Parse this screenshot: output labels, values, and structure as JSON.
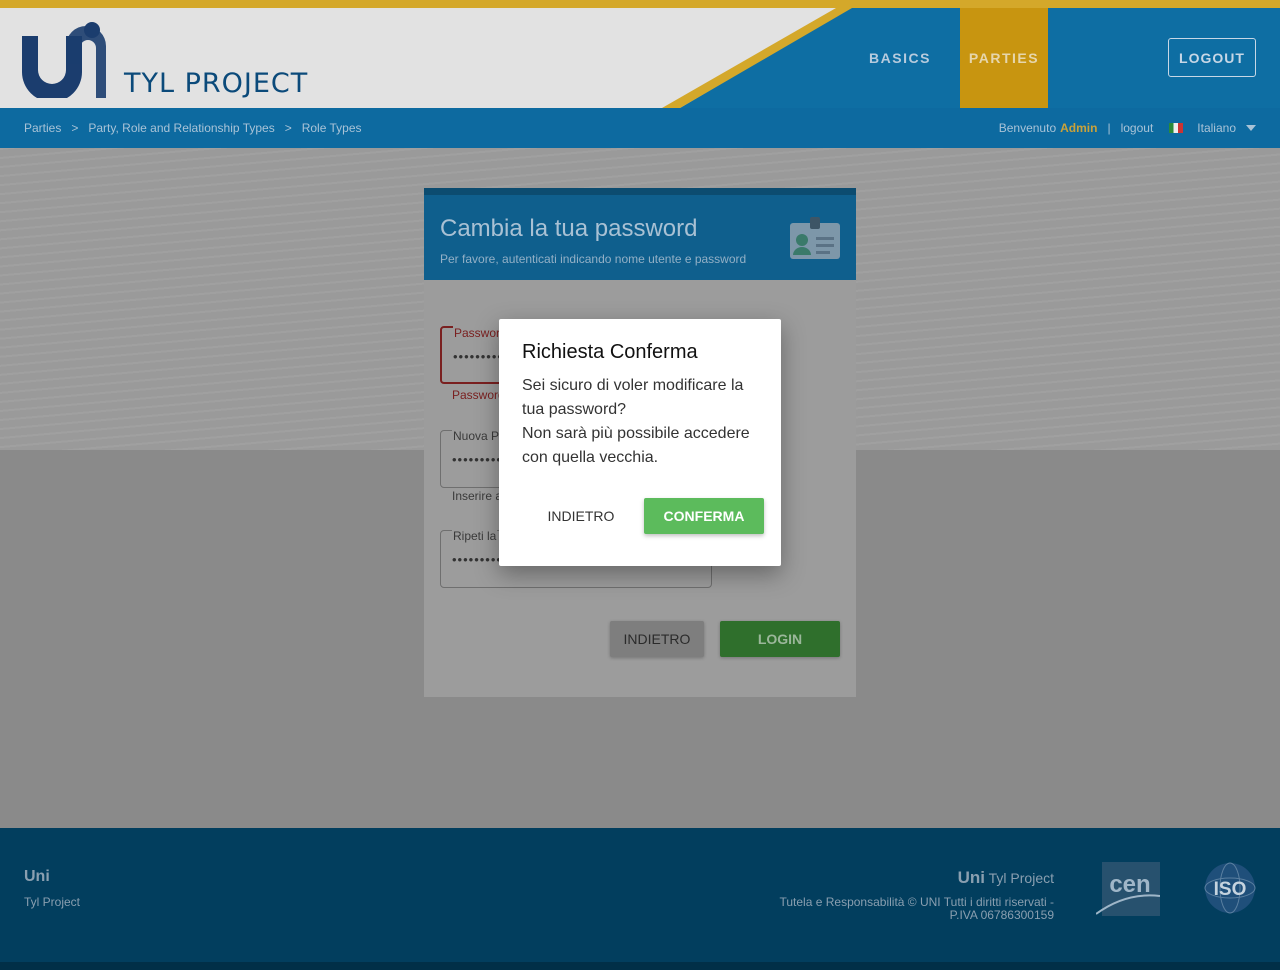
{
  "header": {
    "project_title": "TYL PROJECT",
    "nav": [
      {
        "label": "BASICS"
      },
      {
        "label": "PARTIES"
      }
    ],
    "logout_button": "LOGOUT"
  },
  "breadcrumb": {
    "items": [
      "Parties",
      "Party, Role and Relationship Types",
      "Role Types"
    ],
    "separator": ">"
  },
  "user": {
    "welcome": "Benvenuto",
    "name": "Admin",
    "divider": "|",
    "logout_link": "logout",
    "language": "Italiano"
  },
  "card": {
    "title": "Cambia la tua password",
    "subtitle": "Per favore, autenticati indicando nome utente e password",
    "fields": [
      {
        "label": "Password",
        "value": "••••••••••",
        "helper": "Password"
      },
      {
        "label": "Nuova P",
        "value": "••••••••••",
        "helper": "Inserire a"
      },
      {
        "label": "Ripeti la",
        "value": "••••••••••"
      }
    ],
    "back_button": "INDIETRO",
    "login_button": "LOGIN"
  },
  "dialog": {
    "title": "Richiesta Conferma",
    "line1": "Sei sicuro di voler modificare la tua password?",
    "line2": "Non sarà più possibile accedere con quella vecchia.",
    "back_button": "INDIETRO",
    "confirm_button": "CONFERMA"
  },
  "footer": {
    "left_title": "Uni",
    "left_sub": "Tyl Project",
    "right_brand": "Uni",
    "right_title": "Tyl Project",
    "right_text_a": "Tutela e Responsabilità",
    "right_text_b": "© UNI Tutti i diritti riservati - P.IVA 06786300159",
    "logo_cen_text": "cen",
    "logo_iso_text": "ISO"
  },
  "colors": {
    "accent_gold": "#d4a82a",
    "header_blue": "#0e6ea3",
    "confirm_green": "#5cbb5c",
    "footer_blue": "#023e5e"
  }
}
